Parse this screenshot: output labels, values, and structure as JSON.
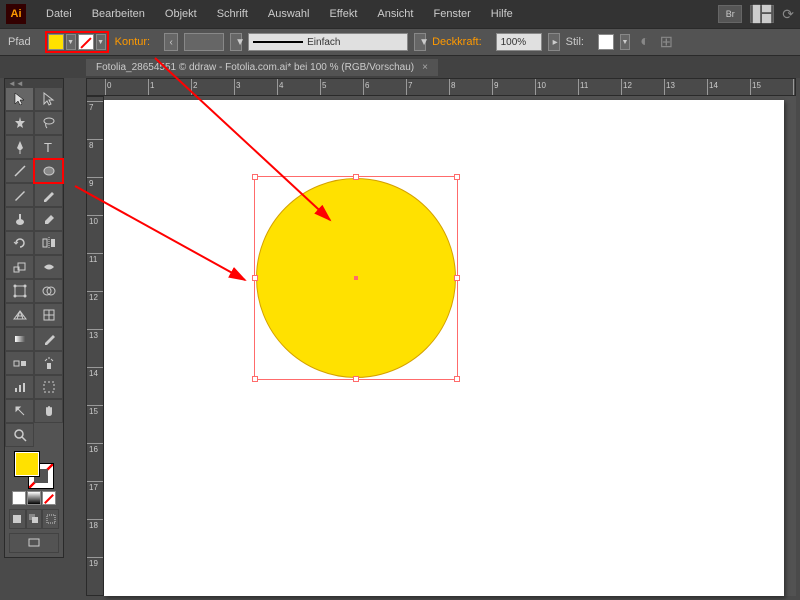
{
  "app": {
    "logo": "Ai"
  },
  "menu": [
    "Datei",
    "Bearbeiten",
    "Objekt",
    "Schrift",
    "Auswahl",
    "Effekt",
    "Ansicht",
    "Fenster",
    "Hilfe"
  ],
  "menu_right": {
    "br": "Br"
  },
  "control": {
    "mode": "Pfad",
    "fill_color": "#ffe100",
    "stroke_none": true,
    "kontur_label": "Kontur:",
    "stroke_weight": "",
    "stroke_style": "Einfach",
    "opacity_label": "Deckkraft:",
    "opacity_value": "100%",
    "stil_label": "Stil:"
  },
  "tab": {
    "title": "Fotolia_28654551 © ddraw - Fotolia.com.ai* bei 100 % (RGB/Vorschau)",
    "close": "×"
  },
  "ruler": {
    "h_start": 0,
    "h_step": 1,
    "h_count": 16,
    "v_start": 7,
    "v_step": 1,
    "v_count": 14
  },
  "colors": {
    "fill": "#ffe100",
    "selection": "#ff6b6b",
    "highlight": "#ff0000"
  }
}
